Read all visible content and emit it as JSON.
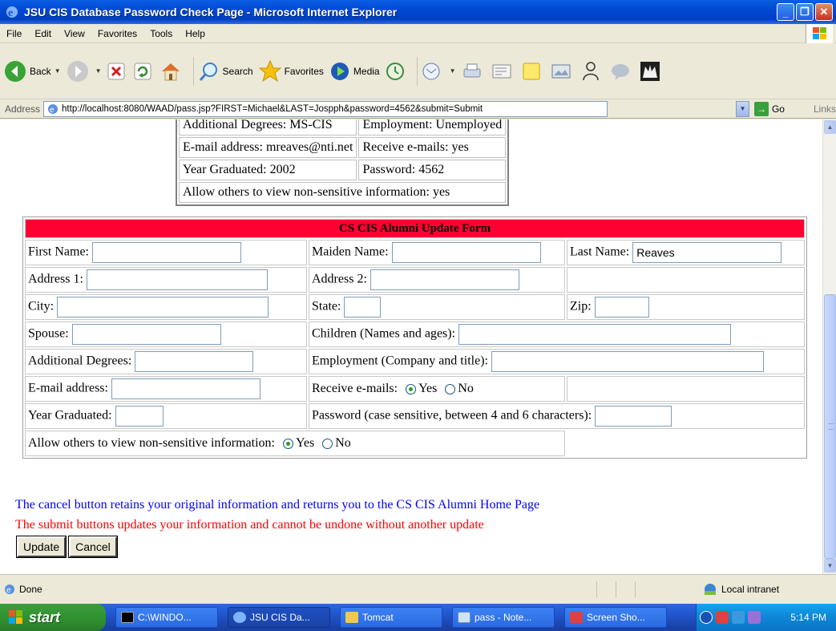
{
  "window": {
    "title": "JSU CIS Database Password Check Page - Microsoft Internet Explorer"
  },
  "menu": [
    "File",
    "Edit",
    "View",
    "Favorites",
    "Tools",
    "Help"
  ],
  "toolbar": {
    "back": "Back",
    "search": "Search",
    "favorites": "Favorites",
    "media": "Media"
  },
  "address": {
    "label": "Address",
    "url": "http://localhost:8080/WAAD/pass.jsp?FIRST=Michael&LAST=Jospph&password=4562&submit=Submit",
    "go": "Go",
    "links": "Links"
  },
  "info": {
    "row0a": "Additional Degrees: MS-CIS",
    "row0b": "Employment: Unemployed",
    "email": "E-mail address: mreaves@nti.net",
    "receive": "Receive e-mails: yes",
    "year": "Year Graduated: 2002",
    "password": "Password: 4562",
    "allow": "Allow others to view non-sensitive information: yes"
  },
  "form": {
    "title": "CS CIS Alumni Update Form",
    "first_name_label": "First Name:",
    "first_name_value": "",
    "maiden_name_label": "Maiden Name:",
    "maiden_name_value": "",
    "last_name_label": "Last Name:",
    "last_name_value": "Reaves",
    "address1_label": "Address 1:",
    "address2_label": "Address 2:",
    "city_label": "City:",
    "state_label": "State:",
    "zip_label": "Zip:",
    "spouse_label": "Spouse:",
    "children_label": "Children (Names and ages):",
    "degrees_label": "Additional Degrees:",
    "employment_label": "Employment (Company and title):",
    "email_label": "E-mail address:",
    "receive_label": "Receive e-mails:",
    "yes": "Yes",
    "no": "No",
    "receive_selected": "Yes",
    "year_label": "Year Graduated:",
    "password_label": "Password (case sensitive, between 4 and 6 characters):",
    "allow_label": "Allow others to view non-sensitive information:",
    "allow_selected": "Yes"
  },
  "notes": {
    "cancel": "The cancel button retains your original information and returns you to the CS CIS Alumni Home Page",
    "submit": "The submit buttons updates your information and cannot be undone without another update"
  },
  "buttons": {
    "update": "Update",
    "cancel": "Cancel"
  },
  "status": {
    "text": "Done",
    "zone": "Local intranet"
  },
  "taskbar": {
    "start": "start",
    "tasks": [
      "C:\\WINDO...",
      "JSU CIS Da...",
      "Tomcat",
      "pass - Note...",
      "Screen Sho..."
    ],
    "clock": "5:14 PM"
  },
  "colors": {
    "form_header": "#ff0033",
    "note_blue": "#0000ff",
    "note_red": "#ff0000"
  }
}
